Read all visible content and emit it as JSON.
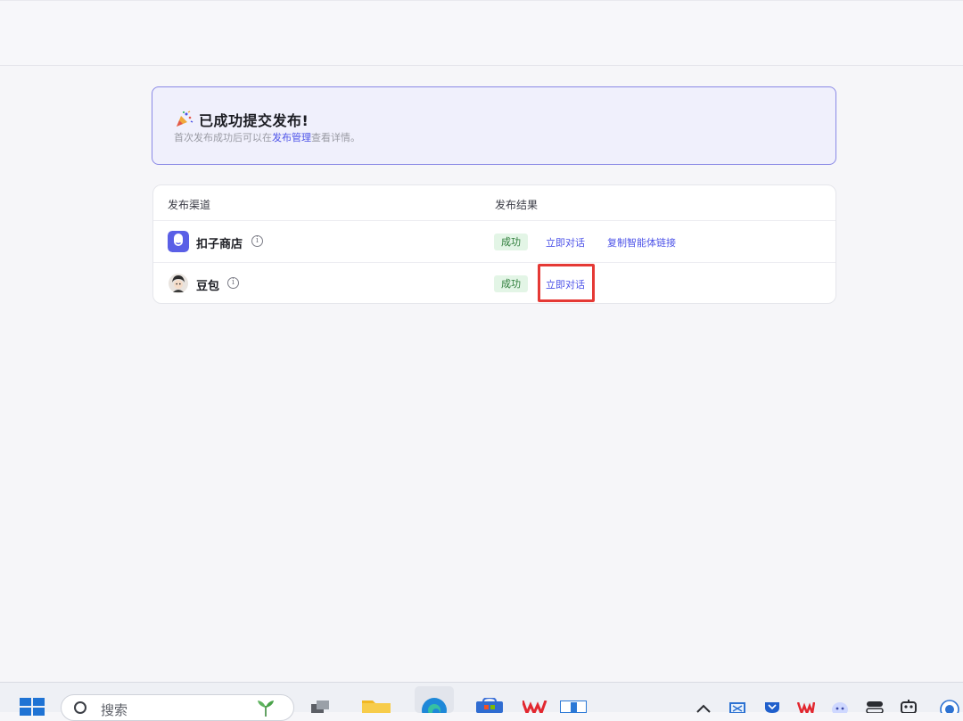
{
  "banner": {
    "title": "已成功提交发布!",
    "sub_prefix": "首次发布成功后可以在",
    "sub_link": "发布管理",
    "sub_suffix": "查看详情。"
  },
  "table": {
    "col_channel": "发布渠道",
    "col_result": "发布结果",
    "rows": [
      {
        "name": "扣子商店",
        "status": "成功",
        "actions": [
          "立即对话",
          "复制智能体链接"
        ]
      },
      {
        "name": "豆包",
        "status": "成功",
        "actions": [
          "立即对话"
        ]
      }
    ]
  },
  "taskbar": {
    "search_placeholder": "搜索"
  },
  "colors": {
    "accent": "#4d53e8",
    "success_bg": "#e3f5e6",
    "success_text": "#2e7d3a",
    "highlight": "#e53935"
  }
}
